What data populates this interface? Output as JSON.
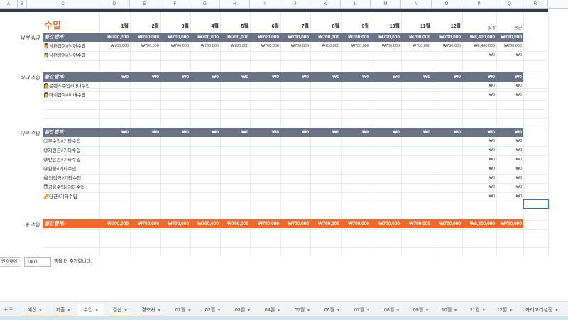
{
  "column_headers": [
    "A",
    "B",
    "C",
    "D",
    "E",
    "F",
    "G",
    "H",
    "I",
    "J",
    "K",
    "L",
    "M",
    "N",
    "O",
    "P",
    "Q",
    "R"
  ],
  "title": "수입",
  "months": [
    "1월",
    "2월",
    "3월",
    "4월",
    "5월",
    "6월",
    "7월",
    "8월",
    "9월",
    "10월",
    "11월",
    "12월"
  ],
  "col_sum": "합계",
  "col_avg": "평균",
  "sections": [
    {
      "label": "남편 임금",
      "band_label": "월간 합계:",
      "band_values": [
        "₩700,000",
        "₩700,000",
        "₩700,000",
        "₩700,000",
        "₩700,000",
        "₩700,000",
        "₩700,000",
        "₩700,000",
        "₩700,000",
        "₩700,000",
        "₩700,000",
        "₩700,000",
        "₩8,400,000",
        "₩700,000"
      ],
      "items": [
        {
          "label": "👩‍💼남편급여#남편수입",
          "values": [
            "₩700,000",
            "₩700,000",
            "₩700,000",
            "₩700,000",
            "₩700,000",
            "₩700,000",
            "₩700,000",
            "₩700,000",
            "₩700,000",
            "₩700,000",
            "₩700,000",
            "₩700,000",
            "₩8,400,000",
            "₩700,000"
          ]
        },
        {
          "label": "👩‍💼남편상여#남편수입",
          "values": [
            "",
            "",
            "",
            "",
            "",
            "",
            "",
            "",
            "",
            "",
            "",
            "",
            "₩0",
            "₩0"
          ]
        }
      ]
    },
    {
      "label": "아내 수입",
      "band_label": "월간 합계:",
      "band_values": [
        "₩0",
        "₩0",
        "₩0",
        "₩0",
        "₩0",
        "₩0",
        "₩0",
        "₩0",
        "₩0",
        "₩0",
        "₩0",
        "₩0",
        "₩0",
        "₩0"
      ],
      "items": [
        {
          "label": "👩콘텐츠수입#아내수입",
          "values": [
            "",
            "",
            "",
            "",
            "",
            "",
            "",
            "",
            "",
            "",
            "",
            "",
            "₩0",
            "₩0"
          ]
        },
        {
          "label": "👩마네급여#아내수입",
          "values": [
            "",
            "",
            "",
            "",
            "",
            "",
            "",
            "",
            "",
            "",
            "",
            "",
            "₩0",
            "₩0"
          ]
        }
      ]
    },
    {
      "label": "기타 수입",
      "band_label": "월간 합계:",
      "band_values": [
        "₩0",
        "₩0",
        "₩0",
        "₩0",
        "₩0",
        "₩0",
        "₩0",
        "₩0",
        "₩0",
        "₩0",
        "₩0",
        "₩0",
        "₩0",
        "₩0"
      ],
      "items": [
        {
          "label": "😍부수입#기타수입",
          "values": [
            "",
            "",
            "",
            "",
            "",
            "",
            "",
            "",
            "",
            "",
            "",
            "",
            "₩0",
            "₩0"
          ]
        },
        {
          "label": "😊지원금#기타수입",
          "values": [
            "",
            "",
            "",
            "",
            "",
            "",
            "",
            "",
            "",
            "",
            "",
            "",
            "₩0",
            "₩0"
          ]
        },
        {
          "label": "😆받은돈#기타수입",
          "values": [
            "",
            "",
            "",
            "",
            "",
            "",
            "",
            "",
            "",
            "",
            "",
            "",
            "₩0",
            "₩0"
          ]
        },
        {
          "label": "😀환불#기타수입",
          "values": [
            "",
            "",
            "",
            "",
            "",
            "",
            "",
            "",
            "",
            "",
            "",
            "",
            "₩0",
            "₩0"
          ]
        },
        {
          "label": "😂퇴직금#기타수입",
          "values": [
            "",
            "",
            "",
            "",
            "",
            "",
            "",
            "",
            "",
            "",
            "",
            "",
            "₩0",
            "₩0"
          ]
        },
        {
          "label": "😇금융수입#기타수입",
          "values": [
            "",
            "",
            "",
            "",
            "",
            "",
            "",
            "",
            "",
            "",
            "",
            "",
            "₩0",
            "₩0"
          ]
        },
        {
          "label": "🥜당근#기타수입",
          "values": [
            "",
            "",
            "",
            "",
            "",
            "",
            "",
            "",
            "",
            "",
            "",
            "",
            "₩0",
            "₩0"
          ]
        }
      ]
    }
  ],
  "total": {
    "label": "총 수입",
    "band_label": "월간 합계:",
    "band_values": [
      "₩700,000",
      "₩700,000",
      "₩700,000",
      "₩700,000",
      "₩700,000",
      "₩700,000",
      "₩700,000",
      "₩700,000",
      "₩700,000",
      "₩700,000",
      "₩700,000",
      "₩700,000",
      "₩8,400,000",
      "₩700,000"
    ]
  },
  "add_rows": {
    "button": "맨 아래에",
    "value": "1000",
    "suffix": "행을 더 추가합니다."
  },
  "sheet_tabs": [
    {
      "label": "예산",
      "color": "#e8710a"
    },
    {
      "label": "지출",
      "color": "#e8710a"
    },
    {
      "label": "수입",
      "color": "#188038",
      "active": true
    },
    {
      "label": "결산",
      "color": "#f6bf26"
    },
    {
      "label": "경조사",
      "color": "#e67c73"
    },
    {
      "label": "01월",
      "color": ""
    },
    {
      "label": "02월",
      "color": ""
    },
    {
      "label": "03월",
      "color": ""
    },
    {
      "label": "04월",
      "color": ""
    },
    {
      "label": "05월",
      "color": ""
    },
    {
      "label": "06월",
      "color": ""
    },
    {
      "label": "07월",
      "color": ""
    },
    {
      "label": "08월",
      "color": ""
    },
    {
      "label": "09월",
      "color": ""
    },
    {
      "label": "10월",
      "color": ""
    },
    {
      "label": "11월",
      "color": ""
    },
    {
      "label": "12월",
      "color": ""
    },
    {
      "label": "카테고리설정",
      "color": ""
    }
  ],
  "icons": {
    "add_sheet": "plus-icon",
    "all_sheets": "menu-icon"
  },
  "colors": {
    "accent": "#f0692a",
    "band": "#6a7386",
    "active_tab": "#188038"
  }
}
